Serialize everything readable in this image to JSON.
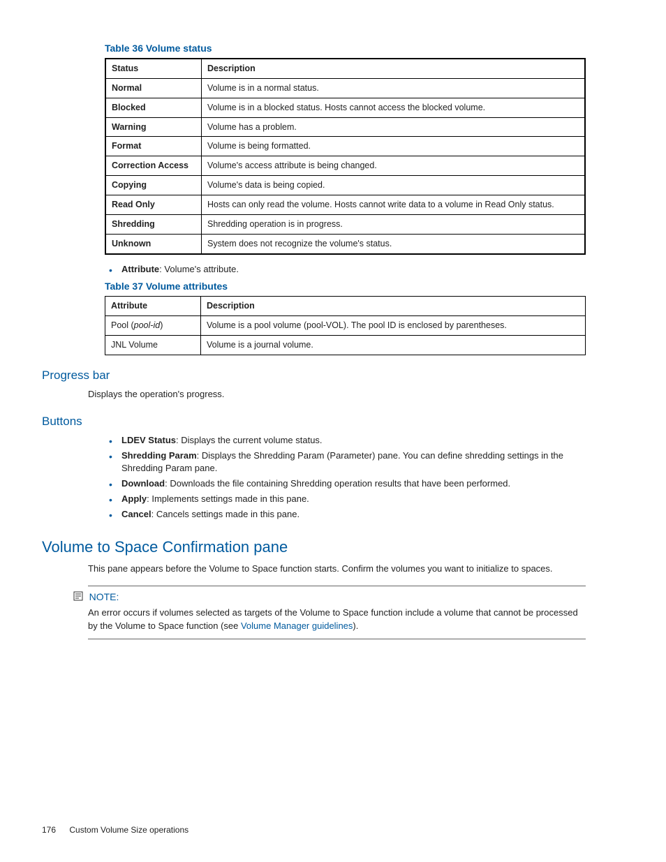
{
  "table36": {
    "caption": "Table 36 Volume status",
    "headers": [
      "Status",
      "Description"
    ],
    "rows": [
      [
        "Normal",
        "Volume is in a normal status."
      ],
      [
        "Blocked",
        "Volume is in a blocked status. Hosts cannot access the blocked volume."
      ],
      [
        "Warning",
        "Volume has a problem."
      ],
      [
        "Format",
        "Volume is being formatted."
      ],
      [
        "Correction Access",
        "Volume's access attribute is being changed."
      ],
      [
        "Copying",
        "Volume's data is being copied."
      ],
      [
        "Read Only",
        "Hosts can only read the volume. Hosts cannot write data to a volume in Read Only status."
      ],
      [
        "Shredding",
        "Shredding operation is in progress."
      ],
      [
        "Unknown",
        "System does not recognize the volume's status."
      ]
    ]
  },
  "attribute_bullet": {
    "label": "Attribute",
    "text": ": Volume's attribute."
  },
  "table37": {
    "caption": "Table 37 Volume attributes",
    "headers": [
      "Attribute",
      "Description"
    ],
    "rows": [
      {
        "c1a": "Pool (",
        "c1b": "pool-id",
        "c1c": ")",
        "c2": "Volume is a pool volume (pool-VOL). The pool ID is enclosed by parentheses."
      },
      {
        "c1a": "JNL Volume",
        "c1b": "",
        "c1c": "",
        "c2": "Volume is a journal volume."
      }
    ]
  },
  "progress": {
    "heading": "Progress bar",
    "text": "Displays the operation's progress."
  },
  "buttons": {
    "heading": "Buttons",
    "items": [
      {
        "label": "LDEV Status",
        "text": ": Displays the current volume status."
      },
      {
        "label": "Shredding Param",
        "text": ": Displays the Shredding Param (Parameter) pane. You can define shredding settings in the Shredding Param pane."
      },
      {
        "label": "Download",
        "text": ": Downloads the file containing Shredding operation results that have been performed."
      },
      {
        "label": "Apply",
        "text": ": Implements settings made in this pane."
      },
      {
        "label": "Cancel",
        "text": ": Cancels settings made in this pane."
      }
    ]
  },
  "vts": {
    "heading": "Volume to Space Confirmation pane",
    "text": "This pane appears before the Volume to Space function starts. Confirm the volumes you want to initialize to spaces."
  },
  "note": {
    "label": "NOTE:",
    "text1": "An error occurs if volumes selected as targets of the Volume to Space function include a volume that cannot be processed by the Volume to Space function (see ",
    "link": "Volume Manager guidelines",
    "text2": ")."
  },
  "footer": {
    "page": "176",
    "section": "Custom Volume Size operations"
  }
}
